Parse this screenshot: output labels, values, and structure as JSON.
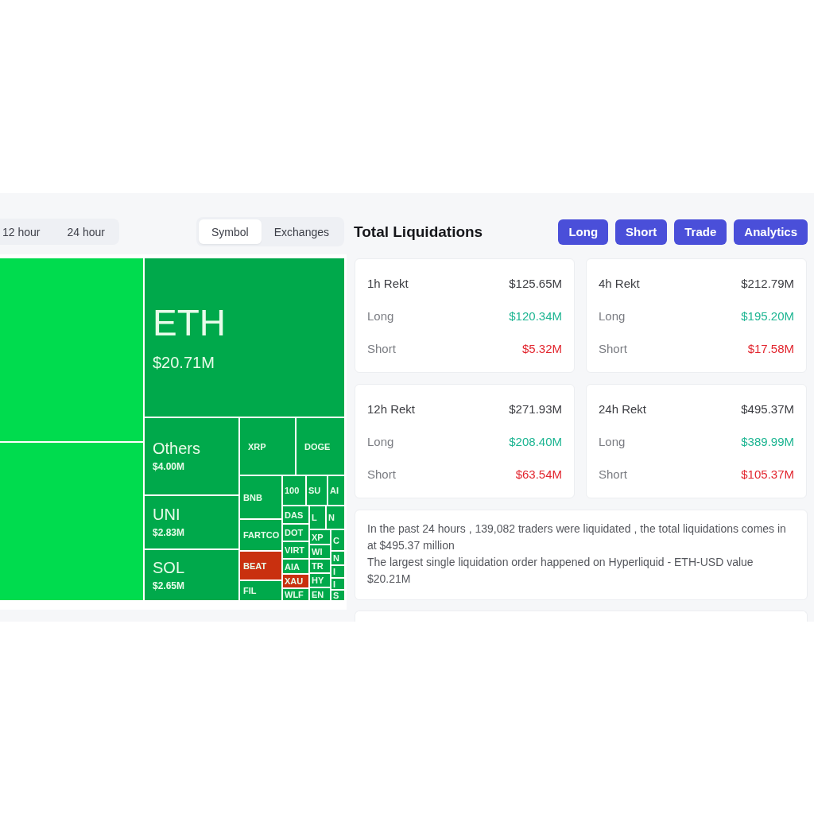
{
  "time_tabs": [
    {
      "label": "12 hour",
      "selected": false
    },
    {
      "label": "24 hour",
      "selected": false
    }
  ],
  "view_tabs": [
    {
      "label": "Symbol",
      "selected": true
    },
    {
      "label": "Exchanges",
      "selected": false
    }
  ],
  "treemap": {
    "tiles": [
      {
        "color": "#00dc4e"
      },
      {
        "color": "#00dc4e"
      },
      {
        "label": "ETH",
        "value": "$20.71M",
        "color": "#00a94b"
      },
      {
        "label": "Others",
        "value": "$4.00M",
        "color": "#00a94b"
      },
      {
        "label": "UNI",
        "value": "$2.83M",
        "color": "#00a94b"
      },
      {
        "label": "SOL",
        "value": "$2.65M",
        "color": "#00a94b"
      },
      {
        "label": "XRP",
        "color": "#00a94b"
      },
      {
        "label": "DOGE",
        "color": "#00a94b"
      },
      {
        "label": "BNB",
        "color": "#00a94b"
      },
      {
        "label": "FARTCO",
        "color": "#00a94b"
      },
      {
        "label": "BEAT",
        "color": "#c9300f"
      },
      {
        "label": "FIL",
        "color": "#00a94b"
      },
      {
        "label": "100",
        "color": "#00a94b"
      },
      {
        "label": "SU",
        "color": "#00a94b"
      },
      {
        "label": "AI",
        "color": "#00a94b"
      },
      {
        "label": "DAS",
        "color": "#00a94b"
      },
      {
        "label": "DOT",
        "color": "#00a94b"
      },
      {
        "label": "VIRT",
        "color": "#00a94b"
      },
      {
        "label": "AIA",
        "color": "#00a94b"
      },
      {
        "label": "XAU",
        "color": "#c9300f"
      },
      {
        "label": "WLF",
        "color": "#00a94b"
      },
      {
        "label": "L",
        "color": "#00a94b"
      },
      {
        "label": "N",
        "color": "#00a94b"
      },
      {
        "label": "XP",
        "color": "#00a94b"
      },
      {
        "label": "C",
        "color": "#00a94b"
      },
      {
        "label": "WI",
        "color": "#00a94b"
      },
      {
        "label": "TR",
        "color": "#00a94b"
      },
      {
        "label": "HY",
        "color": "#00a94b"
      },
      {
        "label": "EN",
        "color": "#00a94b"
      },
      {
        "label": "N",
        "color": "#00a94b"
      },
      {
        "label": "I",
        "color": "#00a94b"
      },
      {
        "label": "I",
        "color": "#00a94b"
      },
      {
        "label": "S",
        "color": "#00a94b"
      }
    ]
  },
  "title": "Total Liquidations",
  "buttons": [
    "Long",
    "Short",
    "Trade",
    "Analytics"
  ],
  "cards": [
    {
      "title": "1h Rekt",
      "total": "$125.65M",
      "rows": [
        {
          "label": "Long",
          "value": "$120.34M",
          "kind": "long"
        },
        {
          "label": "Short",
          "value": "$5.32M",
          "kind": "short"
        }
      ]
    },
    {
      "title": "4h Rekt",
      "total": "$212.79M",
      "rows": [
        {
          "label": "Long",
          "value": "$195.20M",
          "kind": "long"
        },
        {
          "label": "Short",
          "value": "$17.58M",
          "kind": "short"
        }
      ]
    },
    {
      "title": "12h Rekt",
      "total": "$271.93M",
      "rows": [
        {
          "label": "Long",
          "value": "$208.40M",
          "kind": "long"
        },
        {
          "label": "Short",
          "value": "$63.54M",
          "kind": "short"
        }
      ]
    },
    {
      "title": "24h Rekt",
      "total": "$495.37M",
      "rows": [
        {
          "label": "Long",
          "value": "$389.99M",
          "kind": "long"
        },
        {
          "label": "Short",
          "value": "$105.37M",
          "kind": "short"
        }
      ]
    }
  ],
  "summary": [
    "In the past 24 hours , 139,082 traders were liquidated , the total liquidations comes in at $495.37 million",
    "The largest single liquidation order happened on Hyperliquid - ETH-USD value $20.21M"
  ]
}
